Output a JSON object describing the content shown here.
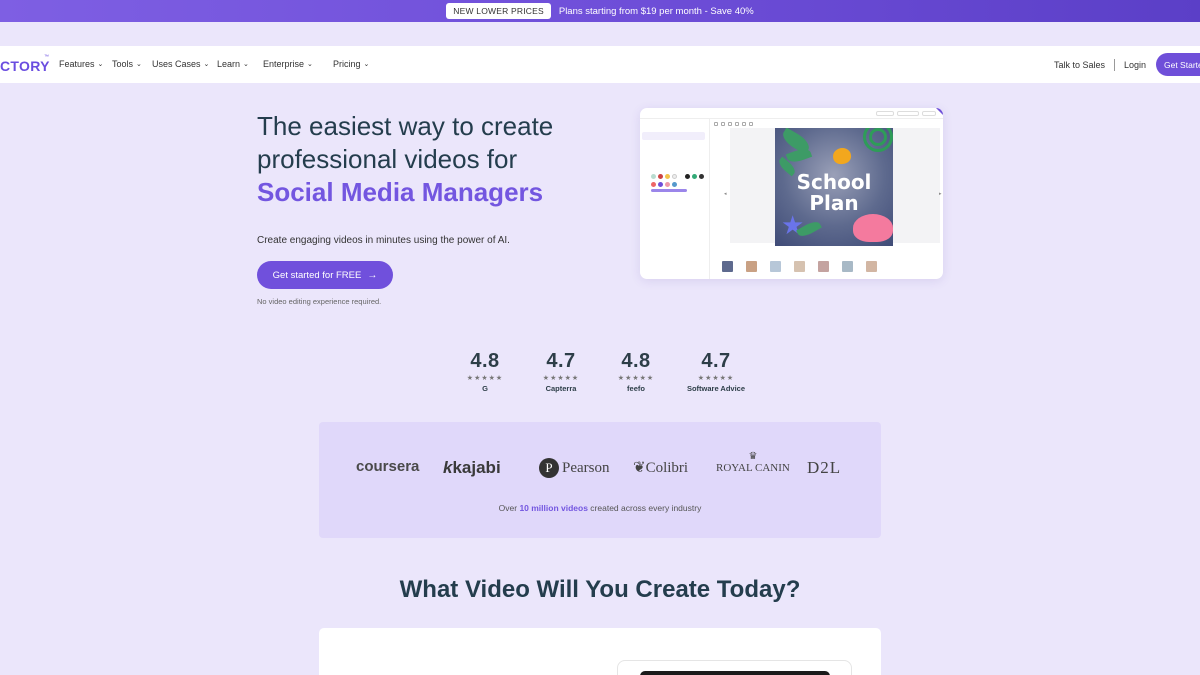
{
  "promo": {
    "pill": "NEW LOWER PRICES",
    "text": "Plans starting from $19 per month - Save 40%"
  },
  "nav": {
    "logo": "CTORY",
    "logo_mark": "™",
    "menu": [
      {
        "label": "Features"
      },
      {
        "label": "Tools"
      },
      {
        "label": "Uses Cases"
      },
      {
        "label": "Learn"
      },
      {
        "label": "Enterprise"
      },
      {
        "label": "Pricing"
      }
    ],
    "talk_to_sales": "Talk to Sales",
    "login": "Login",
    "get_started": "Get Started"
  },
  "hero": {
    "title_line1": "The easiest way to create",
    "title_line2": "professional videos for",
    "title_accent": "Social Media Managers",
    "subtitle": "Create engaging videos in minutes using the power of AI.",
    "cta": "Get started for FREE",
    "cta_icon": "arrow-right-icon",
    "note": "No video editing experience required."
  },
  "preview": {
    "art_title": "School Plan"
  },
  "ratings": [
    {
      "score": "4.8",
      "stars": "★★★★★",
      "source": "G"
    },
    {
      "score": "4.7",
      "stars": "★★★★★",
      "source": "Capterra"
    },
    {
      "score": "4.8",
      "stars": "★★★★★",
      "source": "feefo"
    },
    {
      "score": "4.7",
      "stars": "★★★★★",
      "source": "Software Advice"
    }
  ],
  "logos": {
    "items": [
      "coursera",
      "kajabi",
      "Pearson",
      "Colibri",
      "ROYAL CANIN",
      "D2L"
    ],
    "stat_prefix": "Over ",
    "stat_highlight": "10 million videos",
    "stat_suffix": " created across every industry"
  },
  "section": {
    "title": "What Video Will You Create Today?"
  },
  "colors": {
    "accent": "#7356e0",
    "background": "#ebe6fb",
    "panel": "#e0d8fa"
  }
}
